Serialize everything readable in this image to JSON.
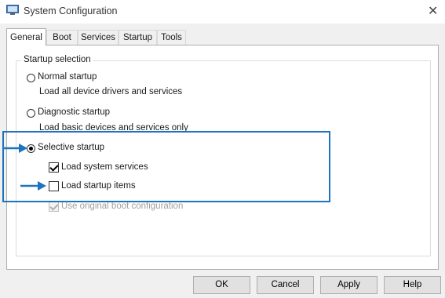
{
  "window": {
    "title": "System Configuration",
    "close_glyph": "✕"
  },
  "tabs": [
    {
      "label": "General",
      "active": true
    },
    {
      "label": "Boot",
      "active": false
    },
    {
      "label": "Services",
      "active": false
    },
    {
      "label": "Startup",
      "active": false
    },
    {
      "label": "Tools",
      "active": false
    }
  ],
  "startup_selection": {
    "legend": "Startup selection",
    "normal": {
      "label": "Normal startup",
      "description": "Load all device drivers and services",
      "selected": false
    },
    "diagnostic": {
      "label": "Diagnostic startup",
      "description": "Load basic devices and services only",
      "selected": false
    },
    "selective": {
      "label": "Selective startup",
      "selected": true
    },
    "load_system_services": {
      "label": "Load system services",
      "checked": true
    },
    "load_startup_items": {
      "label": "Load startup items",
      "checked": false
    },
    "use_original_boot": {
      "label": "Use original boot configuration",
      "checked": true,
      "disabled": true
    }
  },
  "buttons": {
    "ok": "OK",
    "cancel": "Cancel",
    "apply": "Apply",
    "help": "Help"
  },
  "colors": {
    "annotation": "#1e73be",
    "dialog_bg": "#f0f0f0",
    "panel_bg": "#ffffff"
  },
  "icons": {
    "app": "system-configuration-icon",
    "close": "close-icon",
    "annotation_arrow": "arrow-right-icon"
  }
}
